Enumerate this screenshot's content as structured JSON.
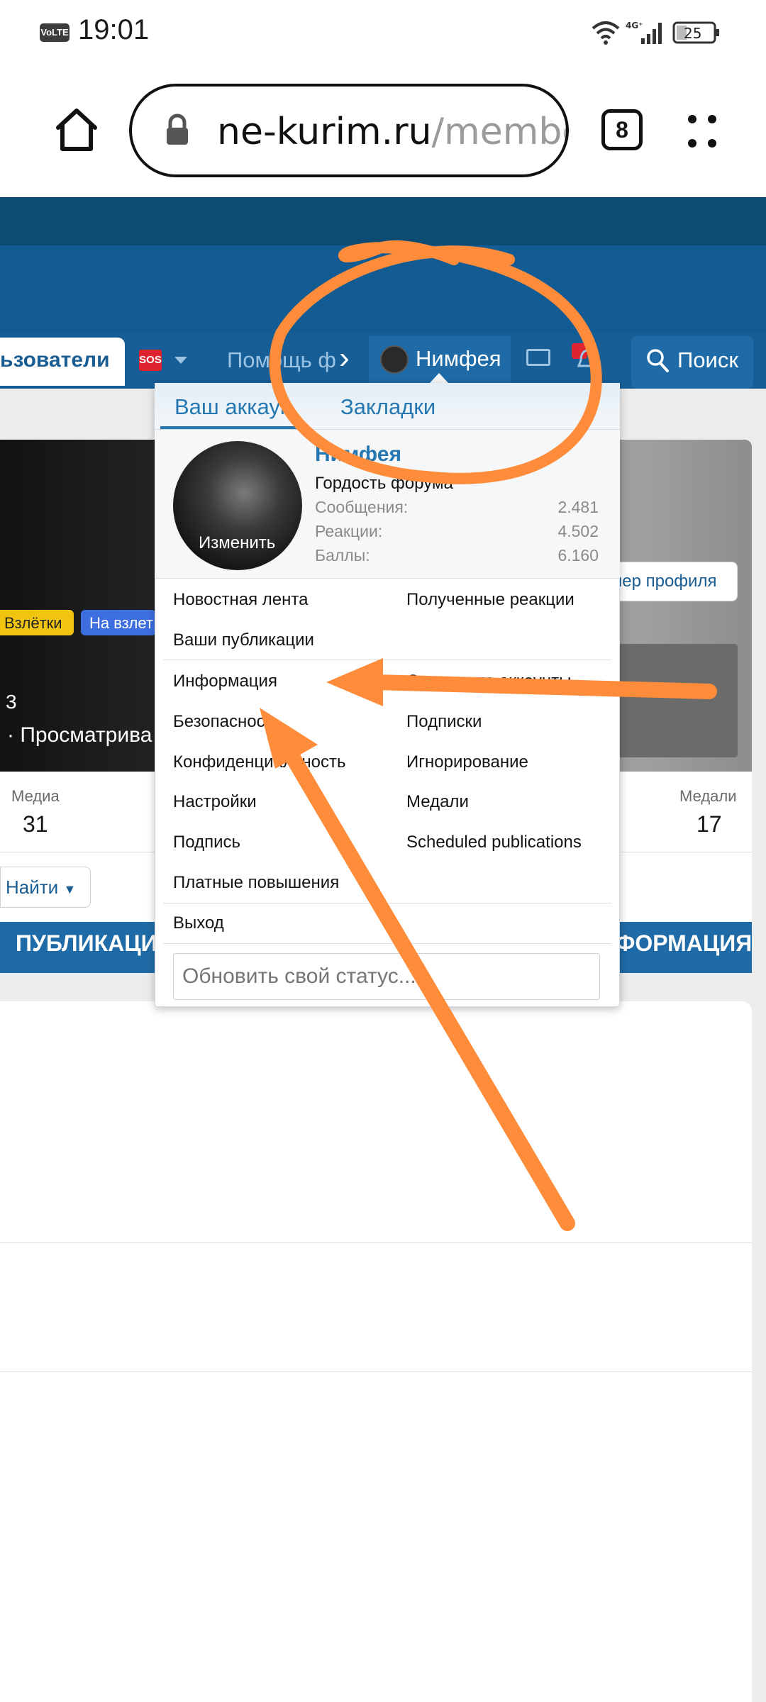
{
  "status_bar": {
    "volte": "VoLTE",
    "time": "19:01",
    "network": "4G⁺",
    "battery": "25"
  },
  "browser": {
    "url_host": "ne-kurim.ru",
    "url_path": "/membe",
    "tab_count": "8"
  },
  "nav": {
    "users": "ьзователи",
    "sos": "SOS",
    "help": "Помощь ф",
    "username": "Нимфея",
    "search": "Поиск"
  },
  "cover": {
    "banner_button": "нер профиля",
    "badge_yellow": "Взлётки",
    "badge_blue": "На взлет",
    "number": "3",
    "viewing": "· Просматрива"
  },
  "stats_bar": {
    "media_label": "Медиа",
    "media_value": "31",
    "medals_label": "Медали",
    "medals_value": "17"
  },
  "find_button": "Найти",
  "tabs": {
    "left": "ПУБЛИКАЦИ",
    "right": "ФОРМАЦИЯ"
  },
  "dropdown": {
    "tab_account": "Ваш аккаун",
    "tab_bookmarks": "Закладки",
    "avatar_edit": "Изменить",
    "name": "Нимфея",
    "title": "Гордость форума",
    "stats": [
      {
        "label": "Сообщения:",
        "value": "2.481"
      },
      {
        "label": "Реакции:",
        "value": "4.502"
      },
      {
        "label": "Баллы:",
        "value": "6.160"
      }
    ],
    "menu_left": [
      "Новостная лента",
      "Ваши публикации"
    ],
    "menu_right": [
      "Полученные реакции"
    ],
    "menu2_left": [
      "Информация",
      "Безопасность",
      "Конфиденциальность",
      "Настройки",
      "Подпись",
      "Платные повышения"
    ],
    "menu2_right": [
      "Связанные аккаунты",
      "Подписки",
      "Игнорирование",
      "Медали",
      "Scheduled publications"
    ],
    "logout": "Выход",
    "status_placeholder": "Обновить свой статус..."
  },
  "annotation_color": "#ff8c3a"
}
